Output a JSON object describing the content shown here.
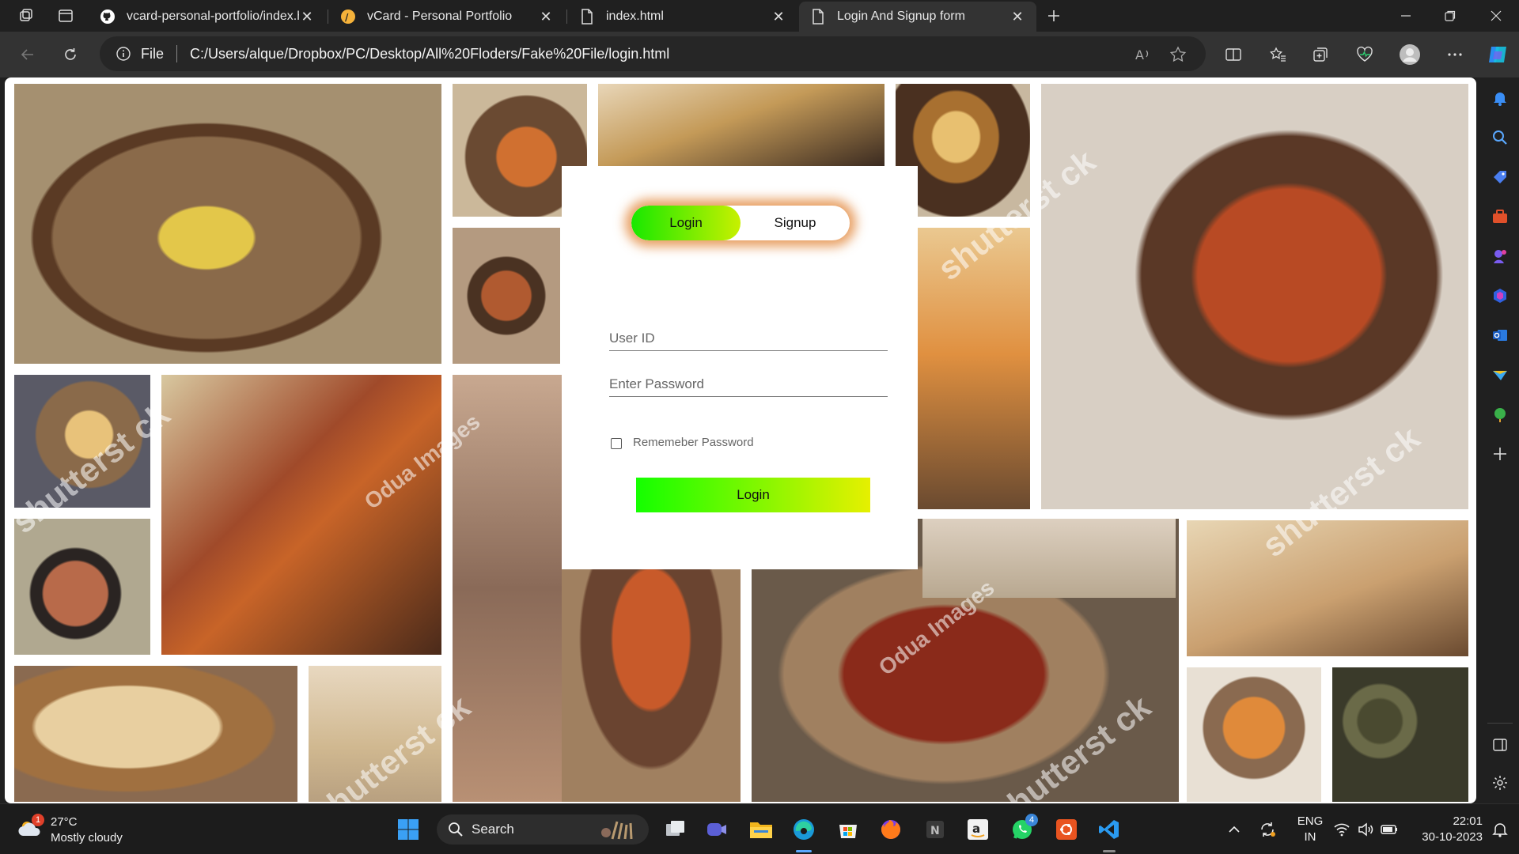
{
  "browser": {
    "tabs": [
      {
        "title": "vcard-personal-portfolio/index.h",
        "icon": "github-icon"
      },
      {
        "title": "vCard - Personal Portfolio",
        "icon": "vcard-icon"
      },
      {
        "title": "index.html",
        "icon": "file-icon"
      },
      {
        "title": "Login And Signup form",
        "icon": "file-icon",
        "active": true
      }
    ],
    "address": {
      "scheme_label": "File",
      "url": "C:/Users/alque/Dropbox/PC/Desktop/All%20Floders/Fake%20File/login.html"
    }
  },
  "page": {
    "toggle": {
      "login_label": "Login",
      "signup_label": "Signup",
      "selected": "Login"
    },
    "form": {
      "user_placeholder": "User ID",
      "password_placeholder": "Enter Password",
      "remember_label": "Rememeber Password",
      "submit_label": "Login"
    },
    "watermarks": [
      "shutterst ck",
      "shutterst ck",
      "Odua Images",
      "shutterst ck",
      "Odua Images",
      "shutterst ck",
      "shutterst ck"
    ],
    "colors": {
      "button_gradient_start": "#14ff00",
      "button_gradient_end": "#e6f000",
      "toggle_glow": "#e08030"
    }
  },
  "taskbar": {
    "weather": {
      "temp": "27°C",
      "condition": "Mostly cloudy",
      "badge": "1"
    },
    "search_label": "Search",
    "whatsapp_badge": "4",
    "lang_top": "ENG",
    "lang_bottom": "IN",
    "time": "22:01",
    "date": "30-10-2023"
  }
}
